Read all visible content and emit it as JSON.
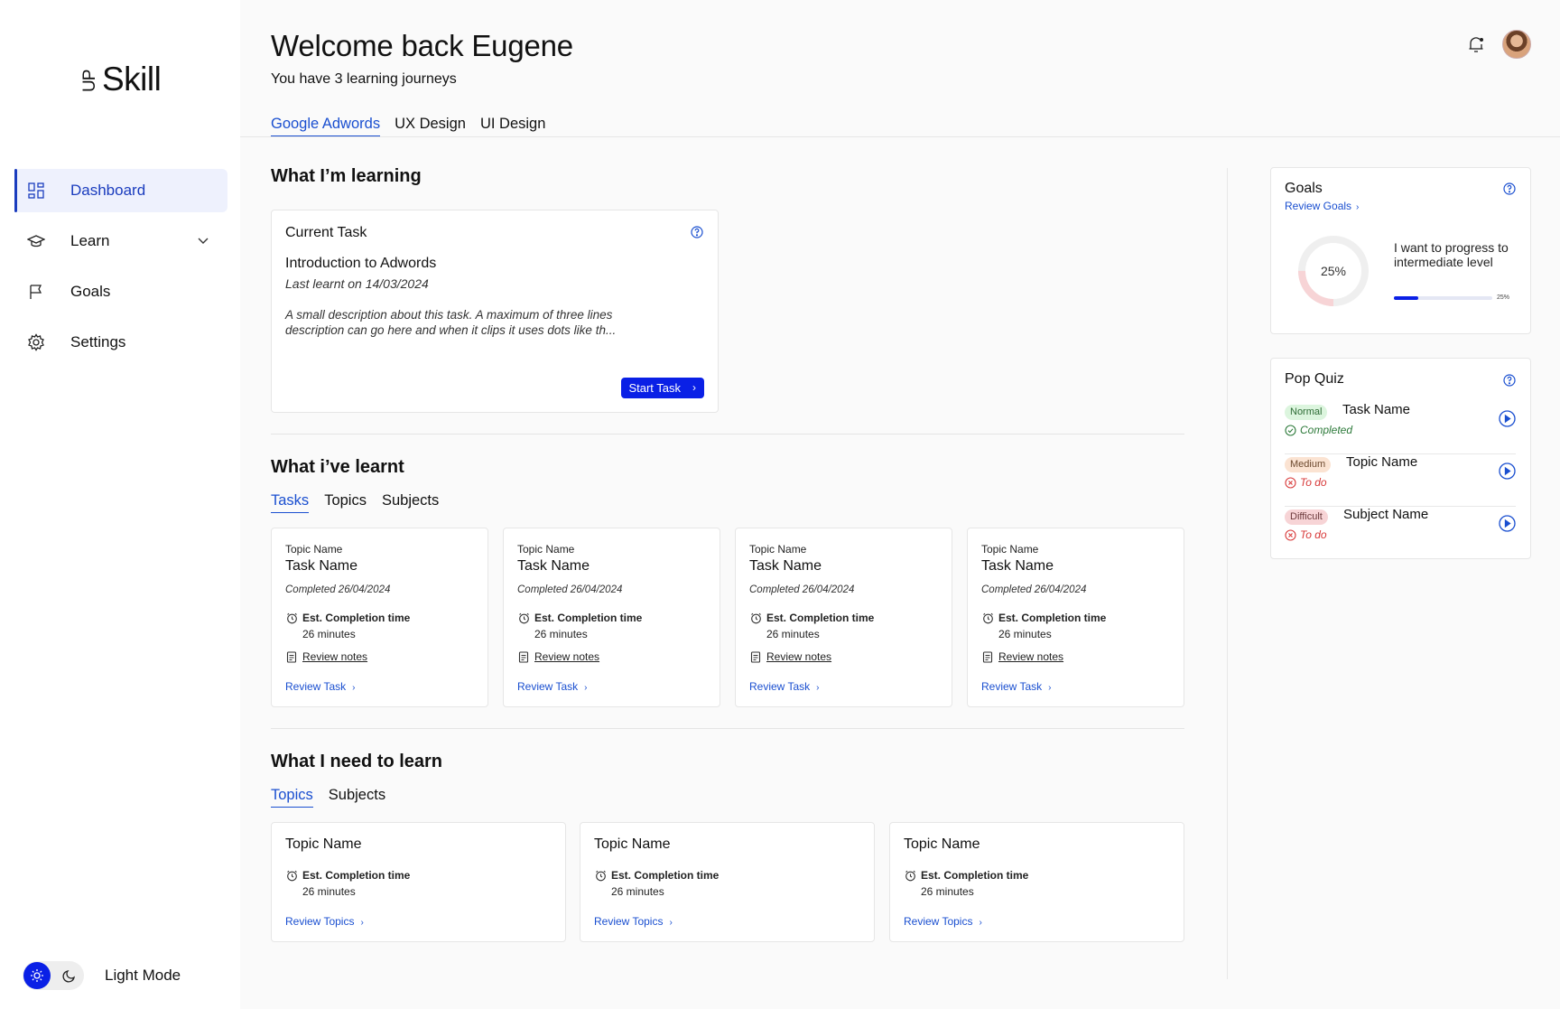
{
  "brand": {
    "logo_up": "UP",
    "logo_skill": "Skill"
  },
  "sidebar": {
    "items": [
      {
        "label": "Dashboard",
        "icon": "grid-icon"
      },
      {
        "label": "Learn",
        "icon": "graduation-cap-icon"
      },
      {
        "label": "Goals",
        "icon": "flag-icon"
      },
      {
        "label": "Settings",
        "icon": "gear-icon"
      }
    ],
    "mode_label": "Light Mode"
  },
  "header": {
    "title": "Welcome back Eugene",
    "subtitle": "You have 3 learning journeys",
    "tabs": [
      "Google Adwords",
      "UX Design",
      "UI Design"
    ],
    "active_tab": "Google Adwords"
  },
  "learning": {
    "title": "What I’m learning",
    "current_task": {
      "heading": "Current Task",
      "name": "Introduction to Adwords",
      "last_learnt": "Last learnt on 14/03/2024",
      "description": "A small description about this task. A maximum of three lines description can go here and when it clips it uses dots like th...",
      "button": "Start Task"
    }
  },
  "learnt": {
    "title": "What i’ve learnt",
    "tabs": [
      "Tasks",
      "Topics",
      "Subjects"
    ],
    "cards": [
      {
        "topic": "Topic Name",
        "name": "Task Name",
        "completed": "Completed 26/04/2024",
        "est_label": "Est. Completion time",
        "est_value": "26 minutes",
        "notes": "Review notes",
        "link": "Review Task"
      },
      {
        "topic": "Topic Name",
        "name": "Task Name",
        "completed": "Completed 26/04/2024",
        "est_label": "Est. Completion time",
        "est_value": "26 minutes",
        "notes": "Review notes",
        "link": "Review Task"
      },
      {
        "topic": "Topic Name",
        "name": "Task Name",
        "completed": "Completed 26/04/2024",
        "est_label": "Est. Completion time",
        "est_value": "26 minutes",
        "notes": "Review notes",
        "link": "Review Task"
      },
      {
        "topic": "Topic Name",
        "name": "Task Name",
        "completed": "Completed 26/04/2024",
        "est_label": "Est. Completion time",
        "est_value": "26 minutes",
        "notes": "Review notes",
        "link": "Review Task"
      }
    ]
  },
  "to_learn": {
    "title": "What I need to learn",
    "tabs": [
      "Topics",
      "Subjects"
    ],
    "cards": [
      {
        "name": "Topic Name",
        "est_label": "Est. Completion time",
        "est_value": "26 minutes",
        "link": "Review Topics"
      },
      {
        "name": "Topic Name",
        "est_label": "Est. Completion time",
        "est_value": "26 minutes",
        "link": "Review Topics"
      },
      {
        "name": "Topic Name",
        "est_label": "Est. Completion time",
        "est_value": "26 minutes",
        "link": "Review Topics"
      }
    ]
  },
  "goals": {
    "title": "Goals",
    "link": "Review Goals",
    "ring_label": "25%",
    "progress": 0.25,
    "text": "I want to progress to intermediate level",
    "bar_label": "25%"
  },
  "quiz": {
    "title": "Pop Quiz",
    "items": [
      {
        "level": "Normal",
        "name": "Task Name",
        "status": "Completed"
      },
      {
        "level": "Medium",
        "name": "Topic Name",
        "status": "To do"
      },
      {
        "level": "Difficult",
        "name": "Subject Name",
        "status": "To do"
      }
    ]
  },
  "colors": {
    "accent": "#0a20e6",
    "link": "#1a4fd0",
    "active_nav_bg": "#eef1fd"
  }
}
